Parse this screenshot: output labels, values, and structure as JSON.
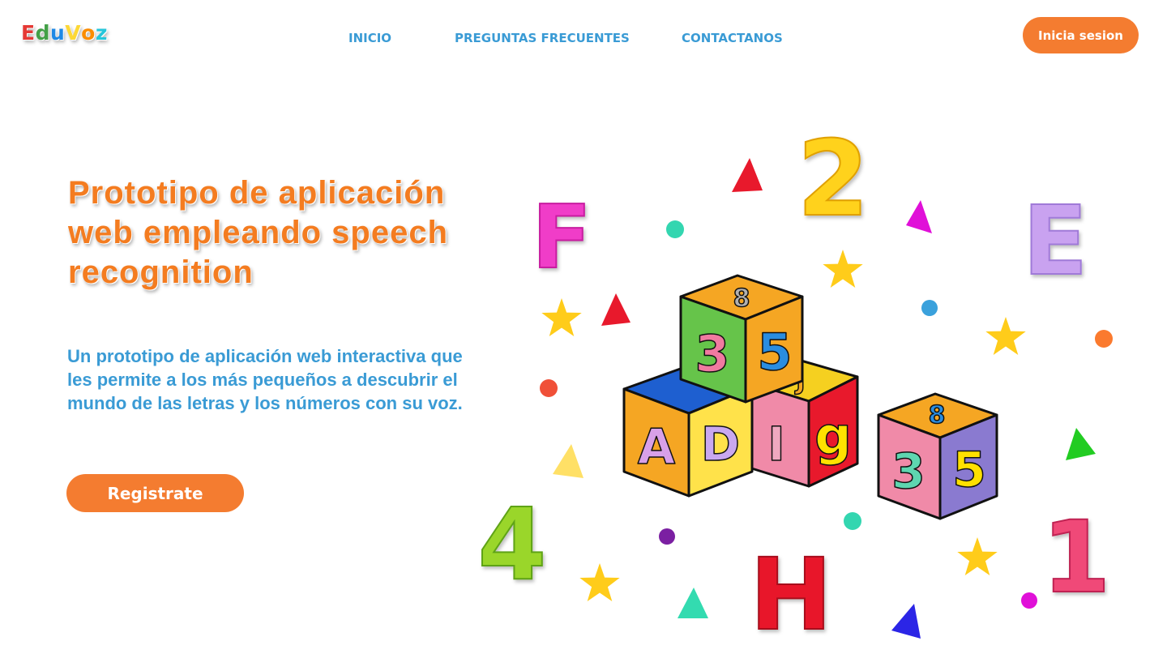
{
  "brand": {
    "letters": [
      {
        "char": "E",
        "color": "#e53935"
      },
      {
        "char": "d",
        "color": "#43a047"
      },
      {
        "char": "u",
        "color": "#1e88e5"
      },
      {
        "char": "V",
        "color": "#fdd835"
      },
      {
        "char": "o",
        "color": "#fb8c00"
      },
      {
        "char": "z",
        "color": "#26c6da"
      }
    ]
  },
  "nav": {
    "inicio": "INICIO",
    "faq": "PREGUNTAS FRECUENTES",
    "contact": "CONTACTANOS"
  },
  "header": {
    "login_label": "Inicia sesion"
  },
  "hero": {
    "title": "Prototipo de aplicación web empleando speech recognition",
    "description": "Un prototipo de aplicación web interactiva que les permite a los más pequeños a descubrir el mundo de las letras y los números con su voz.",
    "register_label": "Registrate"
  },
  "illustration": {
    "floating_chars": [
      {
        "char": "F",
        "color": "#f03cc8"
      },
      {
        "char": "2",
        "color": "#ffd21f"
      },
      {
        "char": "E",
        "color": "#c9a2f0"
      },
      {
        "char": "4",
        "color": "#9ad62c"
      },
      {
        "char": "H",
        "color": "#e8192c"
      },
      {
        "char": "1",
        "color": "#f04878"
      }
    ],
    "blocks": [
      {
        "faces": [
          "8",
          "3",
          "5"
        ]
      },
      {
        "faces": [
          "",
          "A",
          "D"
        ]
      },
      {
        "faces": [
          "J",
          "I",
          "g"
        ]
      },
      {
        "faces": [
          "8",
          "3",
          "5"
        ]
      }
    ]
  },
  "colors": {
    "accent": "#f47c30",
    "nav_text": "#3a9bd5",
    "title": "#f47c20"
  }
}
